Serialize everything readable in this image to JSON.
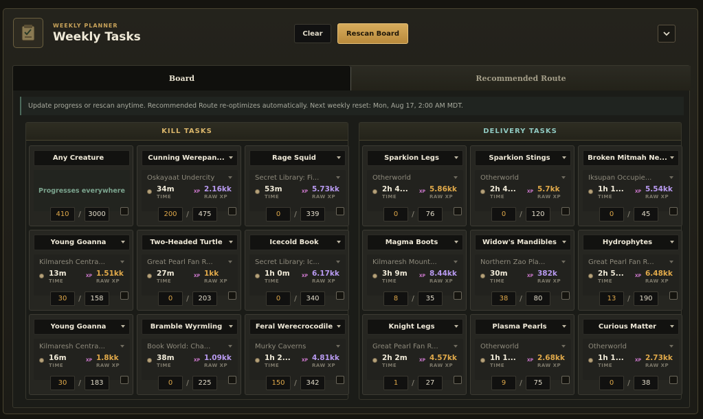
{
  "header": {
    "subtitle": "WEEKLY PLANNER",
    "title": "Weekly Tasks",
    "clear_label": "Clear",
    "rescan_label": "Rescan Board"
  },
  "tabs": [
    {
      "label": "Board",
      "active": true
    },
    {
      "label": "Recommended Route",
      "active": false
    }
  ],
  "notice": "Update progress or rescan anytime. Recommended Route re-optimizes automatically. Next weekly reset: Mon, Aug 17, 2:00 AM MDT.",
  "labels": {
    "time": "TIME",
    "raw_xp": "RAW XP",
    "xp": "XP"
  },
  "kill": {
    "title": "KILL TASKS",
    "cards": [
      {
        "name": "Any Creature",
        "everywhere": "Progresses everywhere",
        "current": "410",
        "total": "3000"
      },
      {
        "name": "Cunning Werepan...",
        "location": "Oskayaat Undercity",
        "time": "34m",
        "xp": "2.16kk",
        "xp_color": "purple",
        "current": "200",
        "total": "475"
      },
      {
        "name": "Rage Squid",
        "location": "Secret Library: Fi...",
        "time": "53m",
        "xp": "5.73kk",
        "xp_color": "purple",
        "current": "0",
        "total": "339"
      },
      {
        "name": "Young Goanna",
        "location": "Kilmaresh Centra...",
        "time": "13m",
        "xp": "1.51kk",
        "xp_color": "gold",
        "current": "30",
        "total": "158"
      },
      {
        "name": "Two-Headed Turtle",
        "location": "Great Pearl Fan R...",
        "time": "27m",
        "xp": "1kk",
        "xp_color": "gold",
        "current": "0",
        "total": "203"
      },
      {
        "name": "Icecold Book",
        "location": "Secret Library: Ic...",
        "time": "1h 0m",
        "xp": "6.17kk",
        "xp_color": "purple",
        "current": "0",
        "total": "340"
      },
      {
        "name": "Young Goanna",
        "location": "Kilmaresh Centra...",
        "time": "16m",
        "xp": "1.8kk",
        "xp_color": "gold",
        "current": "30",
        "total": "183"
      },
      {
        "name": "Bramble Wyrmling",
        "location": "Book World: Cha...",
        "time": "38m",
        "xp": "1.09kk",
        "xp_color": "purple",
        "current": "0",
        "total": "225"
      },
      {
        "name": "Feral Werecrocodile",
        "location": "Murky Caverns",
        "time": "1h 2...",
        "xp": "4.81kk",
        "xp_color": "purple",
        "current": "150",
        "total": "342"
      }
    ]
  },
  "delivery": {
    "title": "DELIVERY TASKS",
    "cards": [
      {
        "name": "Sparkion Legs",
        "location": "Otherworld",
        "time": "2h 4...",
        "xp": "5.86kk",
        "xp_color": "gold",
        "current": "0",
        "total": "76"
      },
      {
        "name": "Sparkion Stings",
        "location": "Otherworld",
        "time": "2h 4...",
        "xp": "5.7kk",
        "xp_color": "gold",
        "current": "0",
        "total": "120"
      },
      {
        "name": "Broken Mitmah Ne...",
        "location": "Iksupan Occupie...",
        "time": "1h 1...",
        "xp": "5.54kk",
        "xp_color": "purple",
        "current": "0",
        "total": "45"
      },
      {
        "name": "Magma Boots",
        "location": "Kilmaresh Mount...",
        "time": "3h 9m",
        "xp": "8.44kk",
        "xp_color": "purple",
        "current": "8",
        "total": "35"
      },
      {
        "name": "Widow's Mandibles",
        "location": "Northern Zao Pla...",
        "time": "30m",
        "xp": "382k",
        "xp_color": "purple",
        "current": "38",
        "total": "80"
      },
      {
        "name": "Hydrophytes",
        "location": "Great Pearl Fan R...",
        "time": "2h 5...",
        "xp": "6.48kk",
        "xp_color": "gold",
        "current": "13",
        "total": "190"
      },
      {
        "name": "Knight Legs",
        "location": "Great Pearl Fan R...",
        "time": "2h 2m",
        "xp": "4.57kk",
        "xp_color": "gold",
        "current": "1",
        "total": "27"
      },
      {
        "name": "Plasma Pearls",
        "location": "Otherworld",
        "time": "1h 1...",
        "xp": "2.68kk",
        "xp_color": "gold",
        "current": "9",
        "total": "75"
      },
      {
        "name": "Curious Matter",
        "location": "Otherworld",
        "time": "1h 1...",
        "xp": "2.73kk",
        "xp_color": "gold",
        "current": "0",
        "total": "38"
      }
    ]
  },
  "icons": {
    "logo": "task-board-icon",
    "collapse": "chevron-down-icon",
    "time": "clock-icon"
  }
}
